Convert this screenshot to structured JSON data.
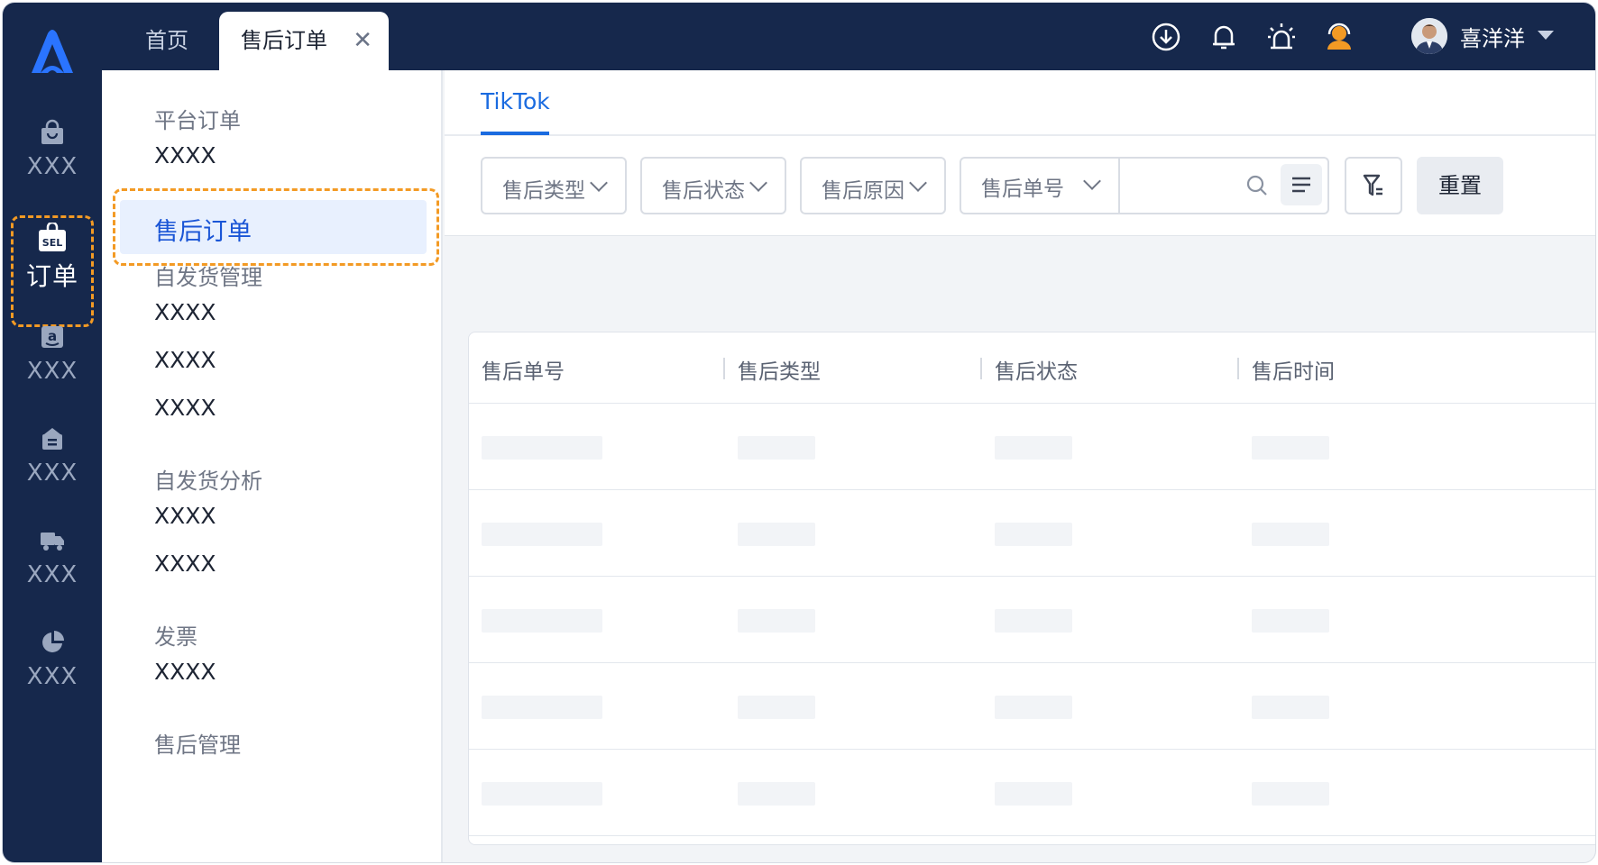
{
  "sidebar": {
    "items": [
      {
        "label": "XXX",
        "icon": "shopping-bag-icon"
      },
      {
        "label": "订单",
        "icon": "sel-tag-icon",
        "active": true
      },
      {
        "label": "XXX",
        "icon": "amazon-icon"
      },
      {
        "label": "XXX",
        "icon": "archive-box-icon"
      },
      {
        "label": "XXX",
        "icon": "truck-icon"
      },
      {
        "label": "XXX",
        "icon": "pie-chart-icon"
      }
    ]
  },
  "topbar": {
    "tabs": [
      {
        "label": "首页"
      },
      {
        "label": "售后订单",
        "active": true
      }
    ],
    "user": {
      "name": "喜洋洋"
    },
    "icons": [
      "download-icon",
      "bell-icon",
      "alarm-icon",
      "support-agent-icon"
    ]
  },
  "submenu": {
    "groups": [
      {
        "title": "平台订单",
        "items": [
          "XXXX",
          "售后订单"
        ]
      },
      {
        "title": "自发货管理",
        "items": [
          "XXXX",
          "XXXX",
          "XXXX"
        ]
      },
      {
        "title": "自发货分析",
        "items": [
          "XXXX",
          "XXXX"
        ]
      },
      {
        "title": "发票",
        "items": [
          "XXXX"
        ]
      },
      {
        "title": "售后管理",
        "items": []
      }
    ]
  },
  "content": {
    "platform_tab": "TikTok",
    "filters": {
      "type": "售后类型",
      "status": "售后状态",
      "reason": "售后原因",
      "number": "售后单号",
      "search_value": ""
    },
    "reset_label": "重置",
    "table": {
      "columns": [
        "售后单号",
        "售后类型",
        "售后状态",
        "售后时间"
      ],
      "rows_loading": 5
    }
  },
  "colors": {
    "nav_bg": "#16284c",
    "accent": "#1a6be0",
    "highlight": "#f39a24"
  }
}
